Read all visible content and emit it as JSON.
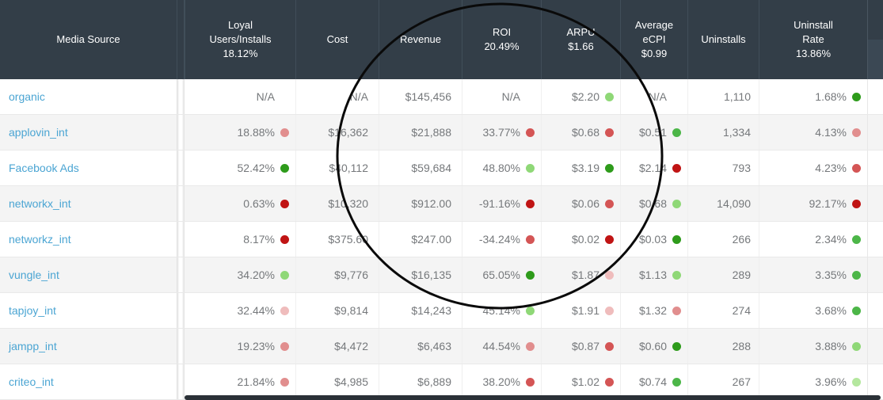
{
  "header": {
    "columns": [
      {
        "id": "media_source",
        "lines": [
          "Media Source"
        ]
      },
      {
        "id": "loyal_users_installs",
        "lines": [
          "Loyal",
          "Users/Installs",
          "18.12%"
        ]
      },
      {
        "id": "cost",
        "lines": [
          "Cost"
        ]
      },
      {
        "id": "revenue",
        "lines": [
          "Revenue"
        ]
      },
      {
        "id": "roi",
        "lines": [
          "ROI",
          "20.49%"
        ]
      },
      {
        "id": "arpu",
        "lines": [
          "ARPU",
          "$1.66"
        ]
      },
      {
        "id": "average_ecpi",
        "lines": [
          "Average",
          "eCPI",
          "$0.99"
        ]
      },
      {
        "id": "uninstalls",
        "lines": [
          "Uninstalls"
        ]
      },
      {
        "id": "uninstall_rate",
        "lines": [
          "Uninstall",
          "Rate",
          "13.86%"
        ]
      }
    ]
  },
  "rows": [
    {
      "source": "organic",
      "loyal": {
        "text": "N/A",
        "dot": null
      },
      "cost": "N/A",
      "revenue": "$145,456",
      "roi": {
        "text": "N/A",
        "dot": null
      },
      "arpu": {
        "text": "$2.20",
        "dot": "light_green"
      },
      "ecpi": {
        "text": "N/A",
        "dot": null
      },
      "uninstalls": "1,110",
      "uninstall_rate": {
        "text": "1.68%",
        "dot": "dark_green"
      }
    },
    {
      "source": "applovin_int",
      "loyal": {
        "text": "18.88%",
        "dot": "salmon"
      },
      "cost": "$16,362",
      "revenue": "$21,888",
      "roi": {
        "text": "33.77%",
        "dot": "red"
      },
      "arpu": {
        "text": "$0.68",
        "dot": "red"
      },
      "ecpi": {
        "text": "$0.51",
        "dot": "green"
      },
      "uninstalls": "1,334",
      "uninstall_rate": {
        "text": "4.13%",
        "dot": "salmon"
      }
    },
    {
      "source": "Facebook Ads",
      "loyal": {
        "text": "52.42%",
        "dot": "dark_green"
      },
      "cost": "$40,112",
      "revenue": "$59,684",
      "roi": {
        "text": "48.80%",
        "dot": "light_green"
      },
      "arpu": {
        "text": "$3.19",
        "dot": "dark_green"
      },
      "ecpi": {
        "text": "$2.14",
        "dot": "dark_red"
      },
      "uninstalls": "793",
      "uninstall_rate": {
        "text": "4.23%",
        "dot": "red"
      }
    },
    {
      "source": "networkx_int",
      "loyal": {
        "text": "0.63%",
        "dot": "dark_red"
      },
      "cost": "$10,320",
      "revenue": "$912.00",
      "roi": {
        "text": "-91.16%",
        "dot": "dark_red"
      },
      "arpu": {
        "text": "$0.06",
        "dot": "red"
      },
      "ecpi": {
        "text": "$0.68",
        "dot": "light_green"
      },
      "uninstalls": "14,090",
      "uninstall_rate": {
        "text": "92.17%",
        "dot": "dark_red"
      }
    },
    {
      "source": "networkz_int",
      "loyal": {
        "text": "8.17%",
        "dot": "dark_red"
      },
      "cost": "$375.60",
      "revenue": "$247.00",
      "roi": {
        "text": "-34.24%",
        "dot": "red"
      },
      "arpu": {
        "text": "$0.02",
        "dot": "dark_red"
      },
      "ecpi": {
        "text": "$0.03",
        "dot": "dark_green"
      },
      "uninstalls": "266",
      "uninstall_rate": {
        "text": "2.34%",
        "dot": "green"
      }
    },
    {
      "source": "vungle_int",
      "loyal": {
        "text": "34.20%",
        "dot": "light_green"
      },
      "cost": "$9,776",
      "revenue": "$16,135",
      "roi": {
        "text": "65.05%",
        "dot": "dark_green"
      },
      "arpu": {
        "text": "$1.87",
        "dot": "pale_red"
      },
      "ecpi": {
        "text": "$1.13",
        "dot": "light_green"
      },
      "uninstalls": "289",
      "uninstall_rate": {
        "text": "3.35%",
        "dot": "green"
      }
    },
    {
      "source": "tapjoy_int",
      "loyal": {
        "text": "32.44%",
        "dot": "pale_red"
      },
      "cost": "$9,814",
      "revenue": "$14,243",
      "roi": {
        "text": "45.14%",
        "dot": "light_green"
      },
      "arpu": {
        "text": "$1.91",
        "dot": "pale_red"
      },
      "ecpi": {
        "text": "$1.32",
        "dot": "salmon"
      },
      "uninstalls": "274",
      "uninstall_rate": {
        "text": "3.68%",
        "dot": "green"
      }
    },
    {
      "source": "jampp_int",
      "loyal": {
        "text": "19.23%",
        "dot": "salmon"
      },
      "cost": "$4,472",
      "revenue": "$6,463",
      "roi": {
        "text": "44.54%",
        "dot": "salmon"
      },
      "arpu": {
        "text": "$0.87",
        "dot": "red"
      },
      "ecpi": {
        "text": "$0.60",
        "dot": "dark_green"
      },
      "uninstalls": "288",
      "uninstall_rate": {
        "text": "3.88%",
        "dot": "light_green"
      }
    },
    {
      "source": "criteo_int",
      "loyal": {
        "text": "21.84%",
        "dot": "salmon"
      },
      "cost": "$4,985",
      "revenue": "$6,889",
      "roi": {
        "text": "38.20%",
        "dot": "red"
      },
      "arpu": {
        "text": "$1.02",
        "dot": "red"
      },
      "ecpi": {
        "text": "$0.74",
        "dot": "green"
      },
      "uninstalls": "267",
      "uninstall_rate": {
        "text": "3.96%",
        "dot": "pale_green"
      }
    }
  ],
  "colors": {
    "header_bg": "#333e48",
    "link_blue": "#4ba5d3",
    "row_alt_bg": "#f4f4f4",
    "text_gray": "#75787b",
    "annotation_circle": "#0a0a0a",
    "dots": {
      "dark_green": "#2e9b1b",
      "green": "#4cb648",
      "light_green": "#8fd877",
      "pale_green": "#b4e79e",
      "dark_red": "#c01414",
      "red": "#d45555",
      "salmon": "#e18e8e",
      "pale_red": "#efbcbc"
    }
  }
}
